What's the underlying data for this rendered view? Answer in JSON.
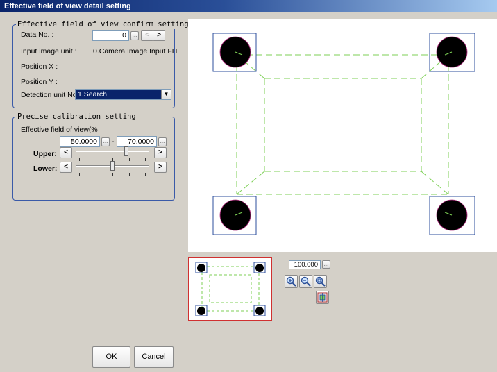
{
  "window": {
    "title": "Effective field of view detail setting"
  },
  "confirm_group": {
    "title": "Effective field of view confirm setting",
    "data_no_label": "Data No. :",
    "data_no_value": "0",
    "input_image_unit_label": "Input image unit :",
    "input_image_unit_value": "0.Camera Image Input FH",
    "position_x_label": "Position X :",
    "position_y_label": "Position Y :",
    "detection_unit_label": "Detection unit No.",
    "detection_unit_value": "1.Search"
  },
  "calibration_group": {
    "title": "Precise calibration setting",
    "field_of_view_label": "Effective field of view(%",
    "range_lower_value": "50.0000",
    "range_separator": "-",
    "range_upper_value": "70.0000",
    "upper_label": "Upper:",
    "lower_label": "Lower:",
    "upper_slider_value": 0.7,
    "lower_slider_value": 0.5
  },
  "buttons": {
    "ok": "OK",
    "cancel": "Cancel",
    "prev_glyph": "<",
    "next_glyph": ">",
    "mini_glyph": "..."
  },
  "zoom": {
    "value": "100.000"
  },
  "icons": [
    "zoom-in-icon",
    "zoom-out-icon",
    "zoom-fit-icon",
    "fit-window-icon"
  ],
  "colors": {
    "title_bar": "#0a246a",
    "group_border": "#3a5aa8",
    "guide_line": "#7ccf54",
    "marker_box": "#2c4f9e",
    "thumbnail_border": "#d03030"
  }
}
